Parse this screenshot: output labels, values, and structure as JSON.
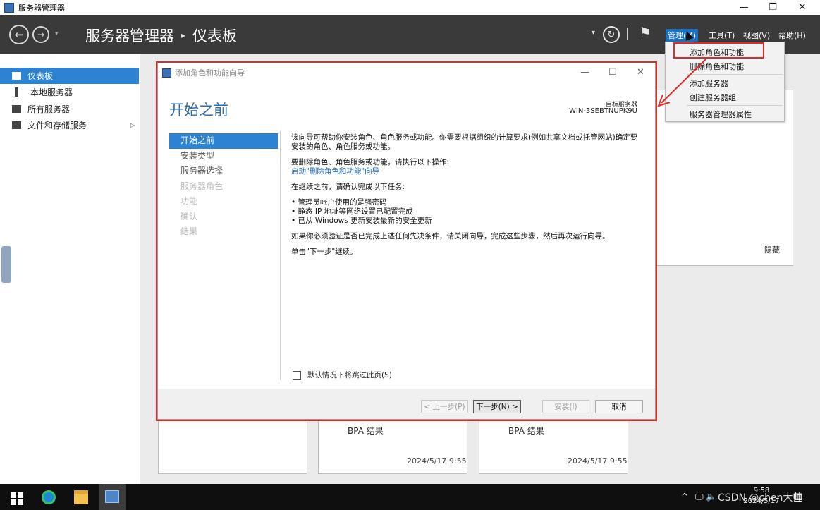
{
  "window": {
    "title": "服务器管理器",
    "controls": [
      "—",
      "❐",
      "✕"
    ]
  },
  "header": {
    "breadcrumb_root": "服务器管理器",
    "breadcrumb_sep": "▸",
    "breadcrumb_current": "仪表板",
    "nav_back": "←",
    "nav_forward": "→",
    "nav_dropdown": "▾",
    "refresh_dropdown": "▾",
    "refresh_glyph": "↻",
    "divider": "|",
    "flag_glyph": "⚑",
    "menus": [
      "管理(M)",
      "工具(T)",
      "视图(V)",
      "帮助(H)"
    ]
  },
  "sidebar": {
    "items": [
      {
        "label": "仪表板",
        "selected": true
      },
      {
        "label": "本地服务器",
        "selected": false
      },
      {
        "label": "所有服务器",
        "selected": false
      },
      {
        "label": "文件和存储服务",
        "selected": false,
        "chevron": "▷"
      }
    ]
  },
  "manage_menu": {
    "items": [
      "添加角色和功能",
      "删除角色和功能",
      "添加服务器",
      "创建服务器组",
      "服务器管理器属性"
    ]
  },
  "dashboard": {
    "hide_label": "隐藏",
    "tiles": [
      {
        "title": "BPA 结果",
        "time": "2024/5/17 9:55"
      },
      {
        "title": "BPA 结果",
        "time": "2024/5/17 9:55"
      }
    ]
  },
  "wizard": {
    "title": "添加角色和功能向导",
    "controls": [
      "—",
      "☐",
      "✕"
    ],
    "heading": "开始之前",
    "target_label": "目标服务器",
    "target_name": "WIN-3SEBTNUPK9U",
    "steps": [
      {
        "label": "开始之前",
        "state": "current"
      },
      {
        "label": "安装类型",
        "state": "reachable"
      },
      {
        "label": "服务器选择",
        "state": "reachable"
      },
      {
        "label": "服务器角色",
        "state": "disabled"
      },
      {
        "label": "功能",
        "state": "disabled"
      },
      {
        "label": "确认",
        "state": "disabled"
      },
      {
        "label": "结果",
        "state": "disabled"
      }
    ],
    "intro": "该向导可帮助你安装角色、角色服务或功能。你需要根据组织的计算要求(例如共享文档或托管网站)确定要安装的角色、角色服务或功能。",
    "remove_hint": "要删除角色、角色服务或功能，请执行以下操作:",
    "remove_link": "启动\"删除角色和功能\"向导",
    "confirm_intro": "在继续之前，请确认完成以下任务:",
    "tasks": [
      "管理员帐户使用的是强密码",
      "静态 IP 地址等网络设置已配置完成",
      "已从 Windows 更新安装最新的安全更新"
    ],
    "prereq_note": "如果你必须验证是否已完成上述任何先决条件，请关闭向导，完成这些步骤，然后再次运行向导。",
    "next_hint": "单击\"下一步\"继续。",
    "skip_label": "默认情况下将跳过此页(S)",
    "buttons": {
      "prev": "< 上一步(P)",
      "next": "下一步(N) >",
      "install": "安装(I)",
      "cancel": "取消"
    }
  },
  "taskbar": {
    "tray_text": "^",
    "tray_icons": "🖵 🔈",
    "clock_time": "9:58",
    "clock_date": "2024/5/17",
    "watermark": "CSDN @chen大帅",
    "notify_glyph": "▤"
  },
  "colors": {
    "header_bg": "#3a3a3a",
    "accent": "#2d83d3",
    "annotation_red": "#e02a2a",
    "heading_blue": "#2c6aa8",
    "link_blue": "#2169b3"
  }
}
